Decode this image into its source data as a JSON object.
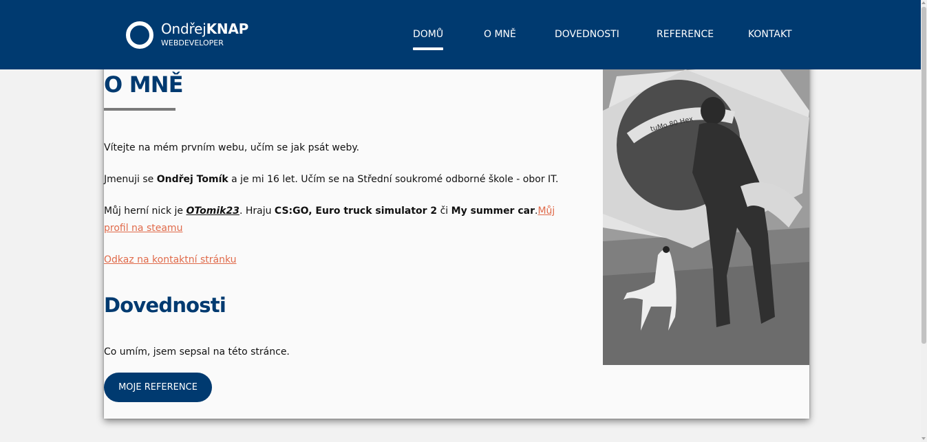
{
  "header": {
    "logo": {
      "name_light": "Ondřej",
      "name_bold": "KNAP",
      "subtitle": "WEBDEVELOPER"
    },
    "nav": [
      {
        "label": "DOMŮ",
        "active": true
      },
      {
        "label": "O MNĚ",
        "active": false
      },
      {
        "label": "DOVEDNOSTI",
        "active": false
      },
      {
        "label": "REFERENCE",
        "active": false
      },
      {
        "label": "KONTAKT",
        "active": false
      }
    ]
  },
  "about": {
    "title": "O MNĚ",
    "p1": "Vítejte na mém prvním webu, učím se jak psát weby.",
    "p2": {
      "pre": "Jmenuji se ",
      "name": "Ondřej Tomík",
      "post": " a je mi 16 let. Učím se na Střední soukromé odborné škole - obor IT."
    },
    "p3": {
      "pre": "Můj herní nick je ",
      "nick": "OTomik23",
      "mid": ". Hraju ",
      "games": "CS:GO, Euro truck simulator 2",
      "ci": " či ",
      "game3": "My summer car",
      "dot": ".",
      "steam_link": "Můj profil na steamu"
    },
    "contact_link": "Odkaz na kontaktní stránku"
  },
  "skills": {
    "title": "Dovednosti",
    "text": "Co umím, jsem sepsal na této stránce.",
    "button": "MOJE REFERENCE"
  },
  "photo": {
    "banner_text": "tuMo 80 Hex"
  },
  "colors": {
    "brand": "#003a70",
    "link": "#e06a4a",
    "background": "#f2f2f2",
    "card": "#fafafa"
  }
}
